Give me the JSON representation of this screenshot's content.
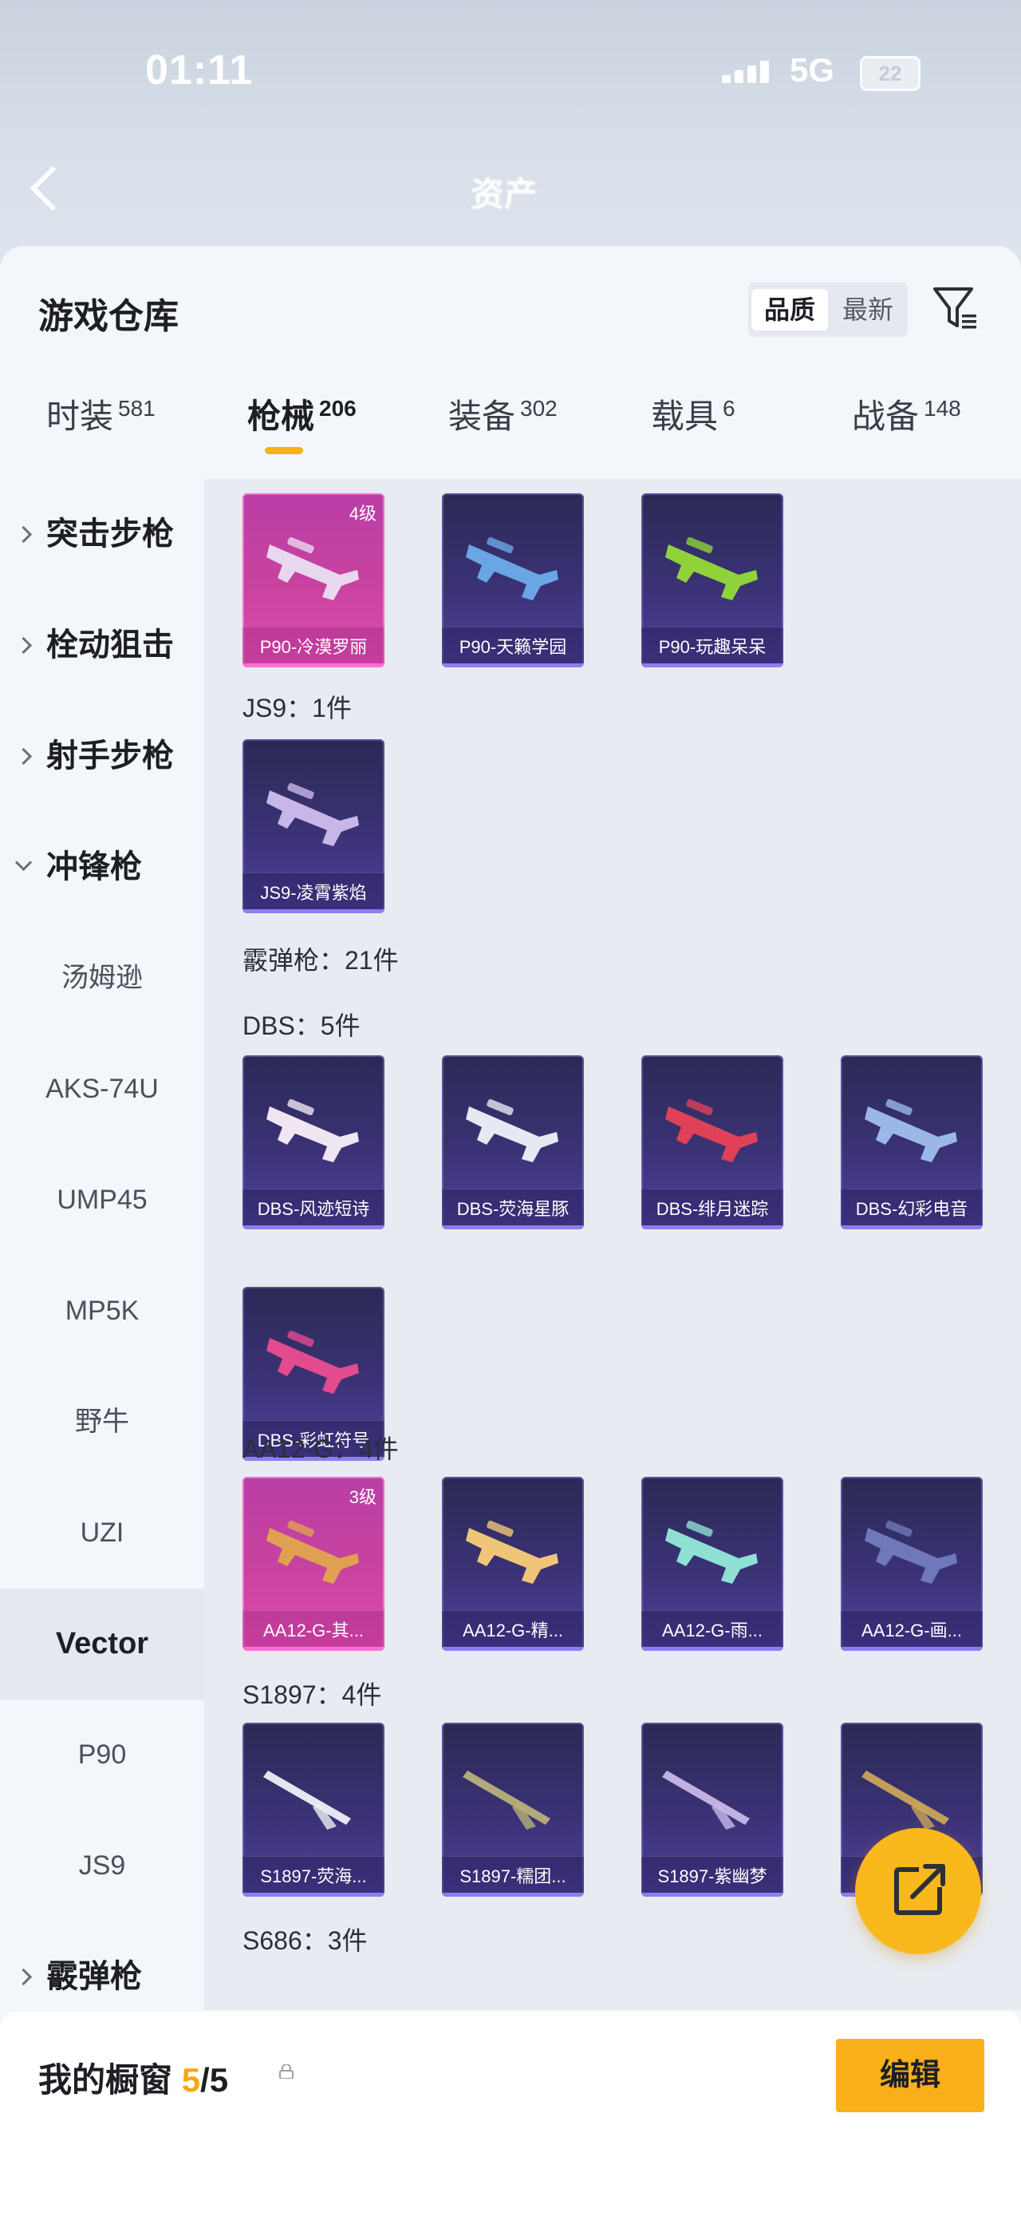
{
  "status": {
    "time": "01:11",
    "network": "5G",
    "battery": "22"
  },
  "header_blur": {
    "tab_text": "资产"
  },
  "sheet": {
    "title": "游戏仓库",
    "sort": {
      "active": "品质",
      "inactive": "最新"
    }
  },
  "categories": [
    {
      "label": "时装",
      "count": "581"
    },
    {
      "label": "枪械",
      "count": "206",
      "active": true
    },
    {
      "label": "装备",
      "count": "302"
    },
    {
      "label": "载具",
      "count": "6"
    },
    {
      "label": "战备",
      "count": "148"
    }
  ],
  "sidebar": {
    "items": [
      {
        "label": "突击步枪",
        "type": "group"
      },
      {
        "label": "栓动狙击",
        "type": "group"
      },
      {
        "label": "射手步枪",
        "type": "group"
      },
      {
        "label": "冲锋枪",
        "type": "group-open"
      },
      {
        "label": "汤姆逊"
      },
      {
        "label": "AKS-74U"
      },
      {
        "label": "UMP45"
      },
      {
        "label": "MP5K"
      },
      {
        "label": "野牛"
      },
      {
        "label": "UZI"
      },
      {
        "label": "Vector",
        "selected": true
      },
      {
        "label": "P90"
      },
      {
        "label": "JS9"
      },
      {
        "label": "霰弹枪",
        "type": "group"
      }
    ]
  },
  "content": {
    "p90_cards": [
      {
        "name": "P90-冷漠罗丽",
        "level": "4级",
        "rarity": "pink",
        "color": "#e8d7ee"
      },
      {
        "name": "P90-天籁学园",
        "rarity": "purple",
        "color": "#6aa6e6"
      },
      {
        "name": "P90-玩趣呆呆",
        "rarity": "purple",
        "color": "#8fd23a"
      }
    ],
    "js9_header": "JS9：1件",
    "js9_cards": [
      {
        "name": "JS9-凌霄紫焰",
        "rarity": "purple",
        "color": "#c9b6e8"
      }
    ],
    "shotgun_header": "霰弹枪：21件",
    "dbs_header": "DBS：5件",
    "dbs_cards": [
      {
        "name": "DBS-风迹短诗",
        "rarity": "purple",
        "color": "#f0e6f2"
      },
      {
        "name": "DBS-荧海星豚",
        "rarity": "purple",
        "color": "#e5e9f2"
      },
      {
        "name": "DBS-绯月迷踪",
        "rarity": "purple",
        "color": "#e04157"
      },
      {
        "name": "DBS-幻彩电音",
        "rarity": "purple",
        "color": "#9bb7e8"
      },
      {
        "name": "DBS-彩虹符号",
        "rarity": "purple",
        "color": "#e24b8f"
      }
    ],
    "aa12_header": "AA12-G：4件",
    "aa12_cards": [
      {
        "name": "AA12-G-其...",
        "level": "3级",
        "rarity": "pink",
        "color": "#e0a052"
      },
      {
        "name": "AA12-G-精...",
        "rarity": "purple",
        "color": "#f0c578"
      },
      {
        "name": "AA12-G-雨...",
        "rarity": "purple",
        "color": "#8fe0d4"
      },
      {
        "name": "AA12-G-画...",
        "rarity": "purple",
        "color": "#6f78b8"
      }
    ],
    "s1897_header": "S1897：4件",
    "s1897_cards": [
      {
        "name": "S1897-荧海...",
        "rarity": "purple",
        "color": "#eef0f6"
      },
      {
        "name": "S1897-糯团...",
        "rarity": "purple",
        "color": "#b8b07a"
      },
      {
        "name": "S1897-紫幽梦",
        "rarity": "purple",
        "color": "#c8b8e8"
      },
      {
        "name": "S1897-...",
        "rarity": "purple",
        "color": "#c9a55a"
      }
    ],
    "s686_header": "S686：3件"
  },
  "bottom": {
    "showcase_label": "我的橱窗",
    "current": "5",
    "total": "/5",
    "edit_label": "编辑"
  },
  "colors": {
    "accent": "#f5b21a",
    "purple_card": "#3b3276",
    "pink_card": "#c9439f"
  }
}
